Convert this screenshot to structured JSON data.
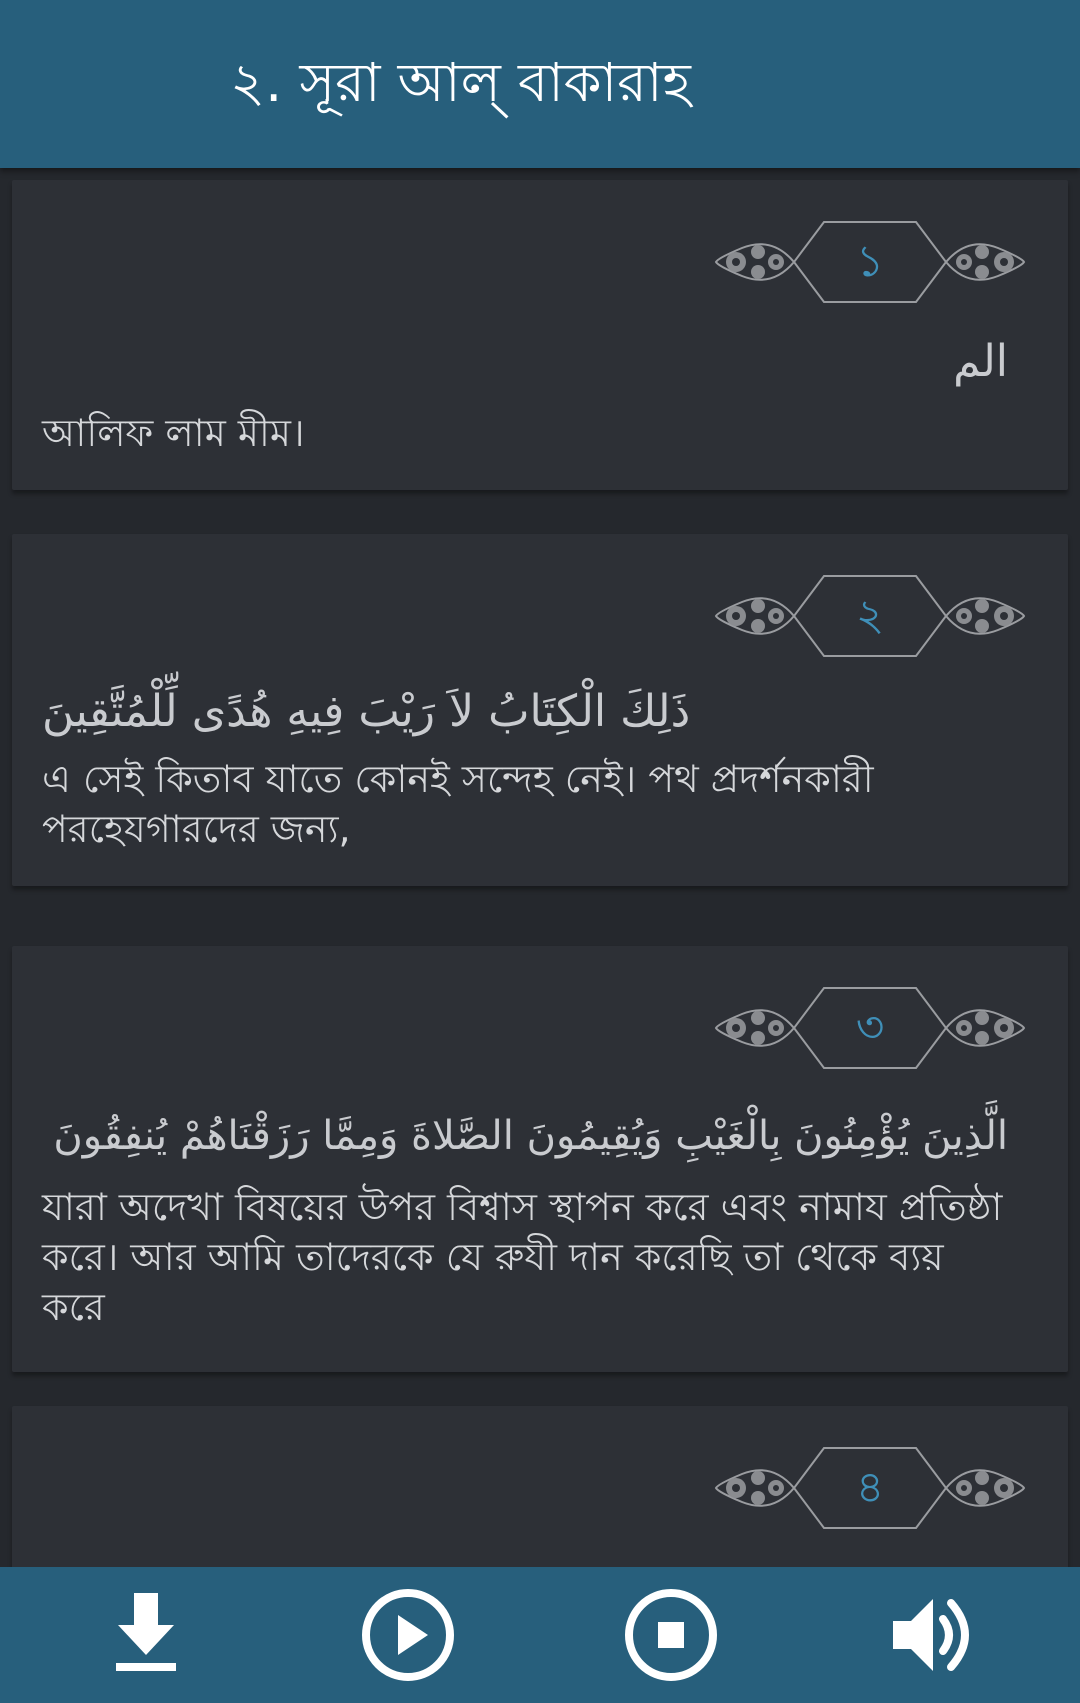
{
  "header": {
    "title": "২. সূরা আল্ বাকারাহ"
  },
  "verses": [
    {
      "number": "১",
      "arabic": "الم",
      "translation": "আলিফ লাম মীম।"
    },
    {
      "number": "২",
      "arabic": "ذَلِكَ الْكِتَابُ لاَ رَيْبَ فِيهِ هُدًى لِّلْمُتَّقِينَ",
      "translation": "এ সেই কিতাব যাতে কোনই সন্দেহ নেই। পথ প্রদর্শনকারী পরহেযগারদের জন্য,"
    },
    {
      "number": "৩",
      "arabic": "الَّذِينَ يُؤْمِنُونَ بِالْغَيْبِ وَيُقِيمُونَ الصَّلاةَ وَمِمَّا رَزَقْنَاهُمْ يُنفِقُونَ",
      "translation": "যারা অদেখা বিষয়ের উপর বিশ্বাস স্থাপন করে এবং নামায প্রতিষ্ঠা করে। আর আমি তাদেরকে যে রুযী দান করেছি তা থেকে ব্যয় করে"
    },
    {
      "number": "৪",
      "arabic": "",
      "translation": ""
    }
  ],
  "controls": {
    "download": "download-icon",
    "play": "play-icon",
    "stop": "stop-icon",
    "volume": "volume-icon"
  },
  "colors": {
    "bar": "#275f7c",
    "background": "#25282d",
    "card": "#2d3036",
    "verse_number": "#3f8fb8"
  }
}
